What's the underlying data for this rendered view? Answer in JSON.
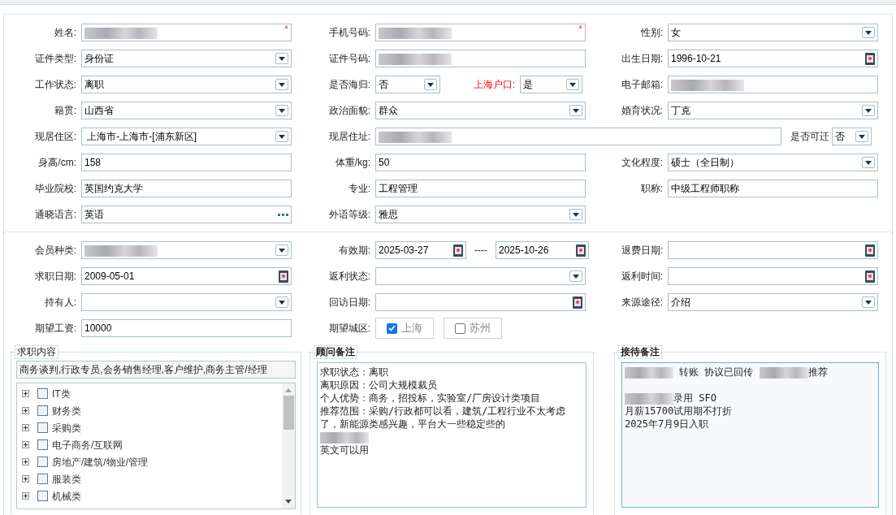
{
  "rows": [
    {
      "cells": [
        {
          "label": "姓名:",
          "field": {
            "kind": "text",
            "redacted": true,
            "required_mark": "*"
          }
        },
        {
          "label": "手机号码:",
          "field": {
            "kind": "text",
            "redacted": true,
            "required_mark": "*"
          }
        },
        {
          "label": "性别:",
          "field": {
            "kind": "select",
            "value": "女"
          }
        }
      ]
    },
    {
      "cells": [
        {
          "label": "证件类型:",
          "field": {
            "kind": "select",
            "value": "身份证"
          }
        },
        {
          "label": "证件号码:",
          "field": {
            "kind": "text",
            "redacted": true
          }
        },
        {
          "label": "出生日期:",
          "field": {
            "kind": "date",
            "value": "1996-10-21"
          }
        }
      ]
    },
    {
      "cells": [
        {
          "label": "工作状态:",
          "field": {
            "kind": "select",
            "value": "离职"
          }
        },
        {
          "label": "是否海归:",
          "field": {
            "kind": "select",
            "value": "否"
          },
          "label2": "上海户口:",
          "label2_alert": true,
          "field2": {
            "kind": "select",
            "value": "是"
          }
        },
        {
          "label": "电子邮箱:",
          "field": {
            "kind": "text",
            "redacted": true
          }
        }
      ]
    },
    {
      "cells": [
        {
          "label": "籍贯:",
          "field": {
            "kind": "select",
            "value": "山西省"
          }
        },
        {
          "label": "政治面貌:",
          "field": {
            "kind": "select",
            "value": "群众"
          }
        },
        {
          "label": "婚育状况:",
          "field": {
            "kind": "select",
            "value": "丁克"
          }
        }
      ]
    },
    {
      "cells": [
        {
          "label": "现居住区:",
          "field": {
            "kind": "select",
            "value": " 上海市-上海市-[浦东新区]"
          }
        },
        {
          "label": "现居住址:",
          "wide": true,
          "field": {
            "kind": "text",
            "redacted": true
          },
          "label2": "是否可迁",
          "field2": {
            "kind": "select",
            "value": "否"
          }
        }
      ]
    },
    {
      "cells": [
        {
          "label": "身高/cm:",
          "field": {
            "kind": "text",
            "value": "158"
          }
        },
        {
          "label": "体重/kg:",
          "field": {
            "kind": "text",
            "value": "50"
          }
        },
        {
          "label": "文化程度:",
          "field": {
            "kind": "select",
            "value": "硕士（全日制）"
          }
        }
      ]
    },
    {
      "cells": [
        {
          "label": "毕业院校:",
          "field": {
            "kind": "text",
            "value": "英国约克大学"
          }
        },
        {
          "label": "专业:",
          "field": {
            "kind": "text",
            "value": "工程管理"
          }
        },
        {
          "label": "职称:",
          "field": {
            "kind": "text",
            "value": "中级工程师职称"
          }
        }
      ]
    },
    {
      "cells": [
        {
          "label": "通晓语言:",
          "field": {
            "kind": "more",
            "value": "英语"
          }
        },
        {
          "label": "外语等级:",
          "field": {
            "kind": "select",
            "value": "雅思"
          }
        }
      ]
    }
  ],
  "rows2": [
    {
      "cells": [
        {
          "label": "会员种类:",
          "field": {
            "kind": "select",
            "redacted": true
          }
        },
        {
          "label": "有效期:",
          "field": {
            "kind": "date",
            "value": "2025-03-27"
          },
          "separator": "----",
          "field2": {
            "kind": "date",
            "value": "2025-10-26"
          }
        },
        {
          "label": "退费日期:",
          "field": {
            "kind": "date"
          }
        }
      ]
    },
    {
      "cells": [
        {
          "label": "求职日期:",
          "field": {
            "kind": "date",
            "value": "2009-05-01"
          }
        },
        {
          "label": "返利状态:",
          "field": {
            "kind": "select"
          }
        },
        {
          "label": "返利时间:",
          "field": {
            "kind": "date"
          }
        }
      ]
    },
    {
      "cells": [
        {
          "label": "持有人:",
          "field": {
            "kind": "select"
          }
        },
        {
          "label": "回访日期:",
          "field": {
            "kind": "date"
          }
        },
        {
          "label": "来源途径:",
          "field": {
            "kind": "select",
            "value": "介绍"
          }
        }
      ]
    },
    {
      "cells": [
        {
          "label": "期望工资:",
          "field": {
            "kind": "text",
            "value": "10000"
          }
        },
        {
          "label": "期望城区:",
          "checks": [
            {
              "label": "上海",
              "checked": true
            },
            {
              "label": "苏州",
              "checked": false
            }
          ]
        }
      ]
    }
  ],
  "job_panel": {
    "title": "求职内容",
    "summary": "商务谈判,行政专员,会务销售经理,客户维护,商务主管/经理",
    "tree": [
      {
        "label": "IT类",
        "checked": false
      },
      {
        "label": "财务类",
        "checked": false
      },
      {
        "label": "采购类",
        "checked": false
      },
      {
        "label": "电子商务/互联网",
        "checked": false
      },
      {
        "label": "房地产/建筑/物业/管理",
        "checked": false
      },
      {
        "label": "服装类",
        "checked": false
      },
      {
        "label": "机械类",
        "checked": false
      }
    ]
  },
  "advisor_panel": {
    "title": "顾问备注",
    "lines": [
      [
        {
          "kind": "text",
          "text": "求职状态：离职"
        }
      ],
      [
        {
          "kind": "text",
          "text": "离职原因：公司大规模裁员"
        }
      ],
      [
        {
          "kind": "text",
          "text": "个人优势：商务，招投标，实验室/厂房设计类项目"
        }
      ],
      [
        {
          "kind": "text",
          "text": "推荐范围：采购/行政都可以看，建筑/工程行业不太考虑了，新能源类感兴趣，平台大一些稳定些的"
        }
      ],
      [
        {
          "kind": "redacted"
        }
      ],
      [
        {
          "kind": "text",
          "text": "英文可以用"
        }
      ]
    ]
  },
  "reception_panel": {
    "title": "接待备注",
    "lines": [
      [
        {
          "kind": "redacted"
        },
        {
          "kind": "text",
          "text": " 转账 协议已回传 "
        },
        {
          "kind": "redacted"
        },
        {
          "kind": "text",
          "text": "推荐"
        }
      ],
      [
        {
          "kind": "blank"
        }
      ],
      [
        {
          "kind": "redacted"
        },
        {
          "kind": "text",
          "text": "录用 SFO"
        }
      ],
      [
        {
          "kind": "text",
          "text": "月薪15700试用期不打折"
        }
      ],
      [
        {
          "kind": "text",
          "text": "2025年7月9日入职"
        }
      ]
    ]
  }
}
